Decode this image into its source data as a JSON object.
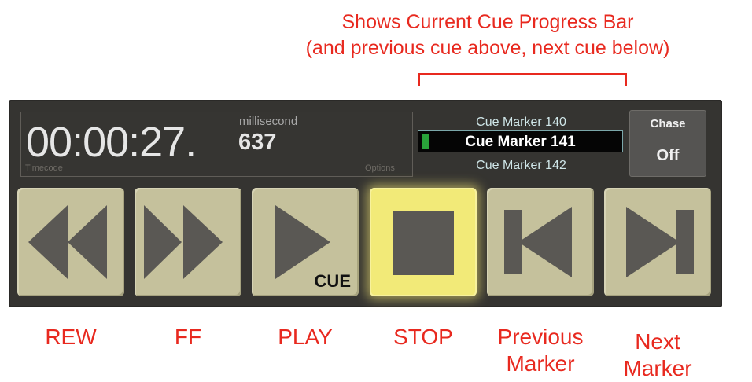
{
  "annotation": {
    "line1": "Shows Current Cue Progress Bar",
    "line2": "(and previous cue above, next cue below)"
  },
  "timecode": {
    "hms": "00:00:27.",
    "ms": "637",
    "unit": "millisecond",
    "label": "Timecode",
    "options_label": "Options"
  },
  "cues": {
    "previous": "Cue Marker 140",
    "current": "Cue Marker 141",
    "next": "Cue Marker 142"
  },
  "chase": {
    "title": "Chase",
    "value": "Off"
  },
  "transport": {
    "play_tag": "CUE",
    "labels": {
      "rew": "REW",
      "ff": "FF",
      "play": "PLAY",
      "stop": "STOP",
      "prev_line1": "Previous",
      "prev_line2": "Marker",
      "next_line1": "Next",
      "next_line2": "Marker"
    }
  },
  "colors": {
    "annotation": "#e8291f",
    "panel": "#353431",
    "button": "#c5c19c",
    "stop_active": "#f2ea78",
    "progress": "#29a23a"
  }
}
